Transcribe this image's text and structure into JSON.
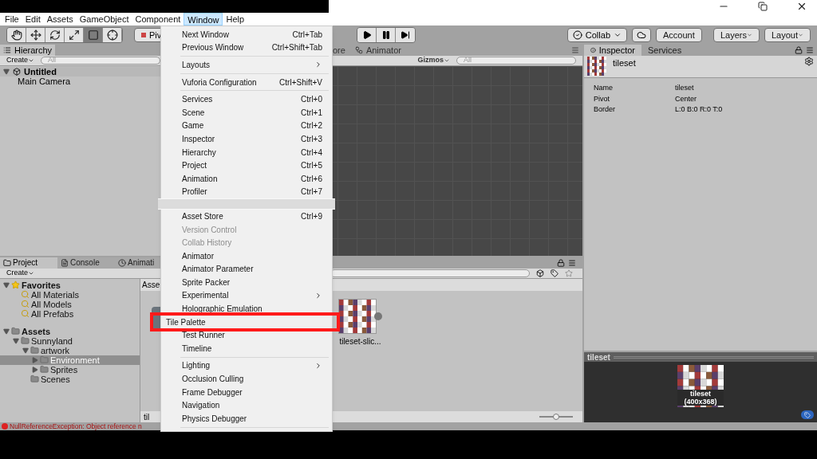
{
  "menu_bar": {
    "items": [
      {
        "label": "File",
        "selected": false
      },
      {
        "label": "Edit",
        "selected": false
      },
      {
        "label": "Assets",
        "selected": false
      },
      {
        "label": "GameObject",
        "selected": false
      },
      {
        "label": "Component",
        "selected": false
      },
      {
        "label": "Window",
        "selected": true
      },
      {
        "label": "Help",
        "selected": false
      }
    ]
  },
  "toolbar": {
    "tools": [
      {
        "kind": "hand",
        "selected": false
      },
      {
        "kind": "move",
        "selected": false
      },
      {
        "kind": "rotate",
        "selected": false
      },
      {
        "kind": "scale",
        "selected": false
      },
      {
        "kind": "rect",
        "selected": true
      },
      {
        "kind": "transform",
        "selected": false
      }
    ],
    "pivot": "Piv",
    "collab": "Collab",
    "account": "Account",
    "layers": "Layers",
    "layout": "Layout"
  },
  "hierarchy": {
    "tab": "Hierarchy",
    "create": "Create",
    "search_placeholder": "All",
    "scene": {
      "name": "Untitled",
      "expanded": true,
      "children": [
        {
          "name": "Main Camera"
        }
      ]
    }
  },
  "scene_view": {
    "tabs": [
      "ore",
      "Animator"
    ],
    "gizmos": "Gizmos",
    "search_placeholder": "All"
  },
  "inspector": {
    "tabs": [
      {
        "label": "Inspector",
        "selected": true
      },
      {
        "label": "Services",
        "selected": false
      }
    ],
    "title": "tileset",
    "fields": [
      {
        "label": "Name",
        "value": "tileset"
      },
      {
        "label": "Pivot",
        "value": "Center"
      },
      {
        "label": "Border",
        "value": "L:0 B:0 R:0 T:0"
      }
    ]
  },
  "preview": {
    "title": "tileset",
    "caption": "tileset",
    "size": "(400x368)"
  },
  "project": {
    "tabs": [
      {
        "label": "Project",
        "kind": "project",
        "selected": true
      },
      {
        "label": "Console",
        "kind": "console",
        "selected": false
      },
      {
        "label": "Animati",
        "kind": "animation",
        "selected": false
      }
    ],
    "create": "Create",
    "tree": [
      {
        "label": "Favorites",
        "kind": "favorites",
        "selected": false,
        "expanded": true,
        "children": [
          {
            "label": "All Materials",
            "kind": "search",
            "selected": false
          },
          {
            "label": "All Models",
            "kind": "search",
            "selected": false
          },
          {
            "label": "All Prefabs",
            "kind": "search",
            "selected": false
          }
        ]
      },
      {
        "label": "Assets",
        "kind": "root",
        "selected": false,
        "expanded": true,
        "children": [
          {
            "label": "Sunnyland",
            "kind": "folder",
            "selected": false,
            "expanded": true,
            "children": [
              {
                "label": "artwork",
                "kind": "folder",
                "selected": false,
                "expanded": true,
                "children": [
                  {
                    "label": "Environment",
                    "kind": "folder",
                    "selected": true,
                    "expanded": false
                  },
                  {
                    "label": "Sprites",
                    "kind": "folder",
                    "selected": false,
                    "expanded": false
                  }
                ]
              },
              {
                "label": "Scenes",
                "kind": "folder",
                "selected": false
              }
            ]
          }
        ]
      }
    ],
    "breadcrumb": "Asse",
    "assets": [
      {
        "label": "tileset-slic..."
      }
    ],
    "footer": "til",
    "zoom_slider": {
      "level": 0.5
    }
  },
  "status_bar": {
    "message": "NullReferenceException: Object reference n"
  },
  "window_menu": {
    "items": [
      {
        "kind": "item",
        "label": "Next Window",
        "shortcut": "Ctrl+Tab"
      },
      {
        "kind": "item",
        "label": "Previous Window",
        "shortcut": "Ctrl+Shift+Tab"
      },
      {
        "kind": "separator"
      },
      {
        "kind": "item",
        "label": "Layouts",
        "submenu": true
      },
      {
        "kind": "separator"
      },
      {
        "kind": "item",
        "label": "Vuforia Configuration",
        "shortcut": "Ctrl+Shift+V"
      },
      {
        "kind": "separator"
      },
      {
        "kind": "item",
        "label": "Services",
        "shortcut": "Ctrl+0"
      },
      {
        "kind": "item",
        "label": "Scene",
        "shortcut": "Ctrl+1"
      },
      {
        "kind": "item",
        "label": "Game",
        "shortcut": "Ctrl+2"
      },
      {
        "kind": "item",
        "label": "Inspector",
        "shortcut": "Ctrl+3"
      },
      {
        "kind": "item",
        "label": "Hierarchy",
        "shortcut": "Ctrl+4"
      },
      {
        "kind": "item",
        "label": "Project",
        "shortcut": "Ctrl+5"
      },
      {
        "kind": "item",
        "label": "Animation",
        "shortcut": "Ctrl+6"
      },
      {
        "kind": "item",
        "label": "Profiler",
        "shortcut": "Ctrl+7"
      },
      {
        "kind": "gap"
      },
      {
        "kind": "item",
        "label": "Asset Store",
        "shortcut": "Ctrl+9"
      },
      {
        "kind": "item",
        "label": "Version Control",
        "disabled": true
      },
      {
        "kind": "item",
        "label": "Collab History",
        "disabled": true
      },
      {
        "kind": "item",
        "label": "Animator"
      },
      {
        "kind": "item",
        "label": "Animator Parameter"
      },
      {
        "kind": "item",
        "label": "Sprite Packer"
      },
      {
        "kind": "item",
        "label": "Experimental",
        "submenu": true
      },
      {
        "kind": "item",
        "label": "Holographic Emulation"
      },
      {
        "kind": "item",
        "label": "Tile Palette",
        "highlighted": true
      },
      {
        "kind": "item",
        "label": "Test Runner"
      },
      {
        "kind": "item",
        "label": "Timeline"
      },
      {
        "kind": "separator"
      },
      {
        "kind": "item",
        "label": "Lighting",
        "submenu": true
      },
      {
        "kind": "item",
        "label": "Occlusion Culling"
      },
      {
        "kind": "item",
        "label": "Frame Debugger"
      },
      {
        "kind": "item",
        "label": "Navigation"
      },
      {
        "kind": "item",
        "label": "Physics Debugger"
      },
      {
        "kind": "separator"
      }
    ]
  }
}
